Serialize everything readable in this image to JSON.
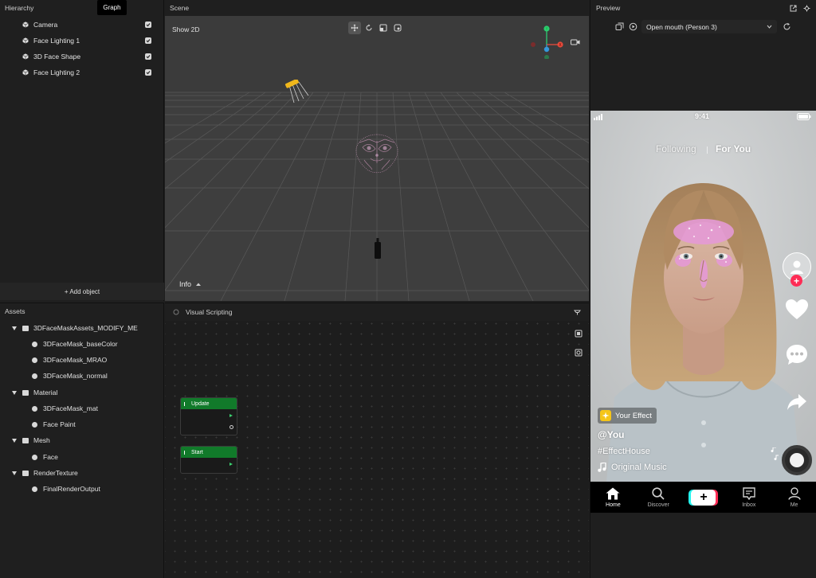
{
  "hierarchy": {
    "title": "Hierarchy",
    "tab": "Graph",
    "items": [
      {
        "label": "Camera"
      },
      {
        "label": "Face Lighting 1"
      },
      {
        "label": "3D Face Shape"
      },
      {
        "label": "Face Lighting 2"
      }
    ],
    "add_object": "+ Add object"
  },
  "assets": {
    "title": "Assets",
    "items": [
      {
        "label": "3DFaceMaskAssets_MODIFY_ME",
        "kind": "folder",
        "level": 0
      },
      {
        "label": "3DFaceMask_baseColor",
        "kind": "file",
        "level": 1
      },
      {
        "label": "3DFaceMask_MRAO",
        "kind": "file",
        "level": 1
      },
      {
        "label": "3DFaceMask_normal",
        "kind": "file",
        "level": 1
      },
      {
        "label": "Material",
        "kind": "folder",
        "level": 0
      },
      {
        "label": "3DFaceMask_mat",
        "kind": "file",
        "level": 1
      },
      {
        "label": "Face Paint",
        "kind": "file",
        "level": 1
      },
      {
        "label": "Mesh",
        "kind": "folder",
        "level": 0
      },
      {
        "label": "Face",
        "kind": "file",
        "level": 1
      },
      {
        "label": "RenderTexture",
        "kind": "folder",
        "level": 0
      },
      {
        "label": "FinalRenderOutput",
        "kind": "file",
        "level": 1
      }
    ]
  },
  "scene": {
    "title": "Scene",
    "show2d": "Show 2D",
    "info": "Info",
    "axes": {
      "y": "Y",
      "x": "X"
    }
  },
  "visual_scripting": {
    "title": "Visual Scripting",
    "nodes": [
      {
        "label": "Update"
      },
      {
        "label": "Start"
      }
    ]
  },
  "preview": {
    "title": "Preview",
    "selected_option": "Open mouth (Person 3)",
    "phone": {
      "time": "9:41",
      "tab_following": "Following",
      "tab_for_you": "For You",
      "effect_badge": "Your Effect",
      "username": "@You",
      "hashtag": "#EffectHouse",
      "music": "Original Music",
      "nav": [
        "Home",
        "Discover",
        "Inbox",
        "Me"
      ]
    }
  },
  "colors": {
    "node_header": "#117a2a",
    "exec_port": "#3bd16f",
    "accent_pink": "#fe2c55",
    "accent_cyan": "#25f4ee",
    "effect_badge_icon": "#f5c518"
  }
}
